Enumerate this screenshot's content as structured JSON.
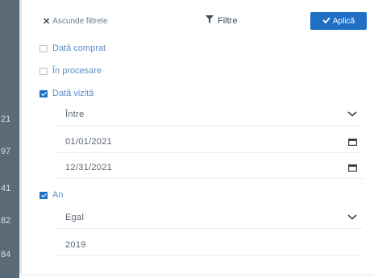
{
  "background_numbers": [
    "21",
    "97",
    "41",
    "82",
    "84"
  ],
  "header": {
    "hide_filters_label": "Ascunde filtrele",
    "title": "Filtre",
    "apply_label": "Aplică"
  },
  "options": [
    {
      "label": "Dată comprat",
      "checked": false
    },
    {
      "label": "În procesare",
      "checked": false
    },
    {
      "label": "Dată vizită",
      "checked": true
    }
  ],
  "date_filter": {
    "operator": "Între",
    "from": "01/01/2021",
    "to": "12/31/2021"
  },
  "year_filter": {
    "label": "An",
    "checked": true,
    "operator": "Egal",
    "value": "2019"
  },
  "colors": {
    "accent": "#1f6fc4",
    "link": "#5b8ec9",
    "side_strip": "#5a6b77"
  }
}
